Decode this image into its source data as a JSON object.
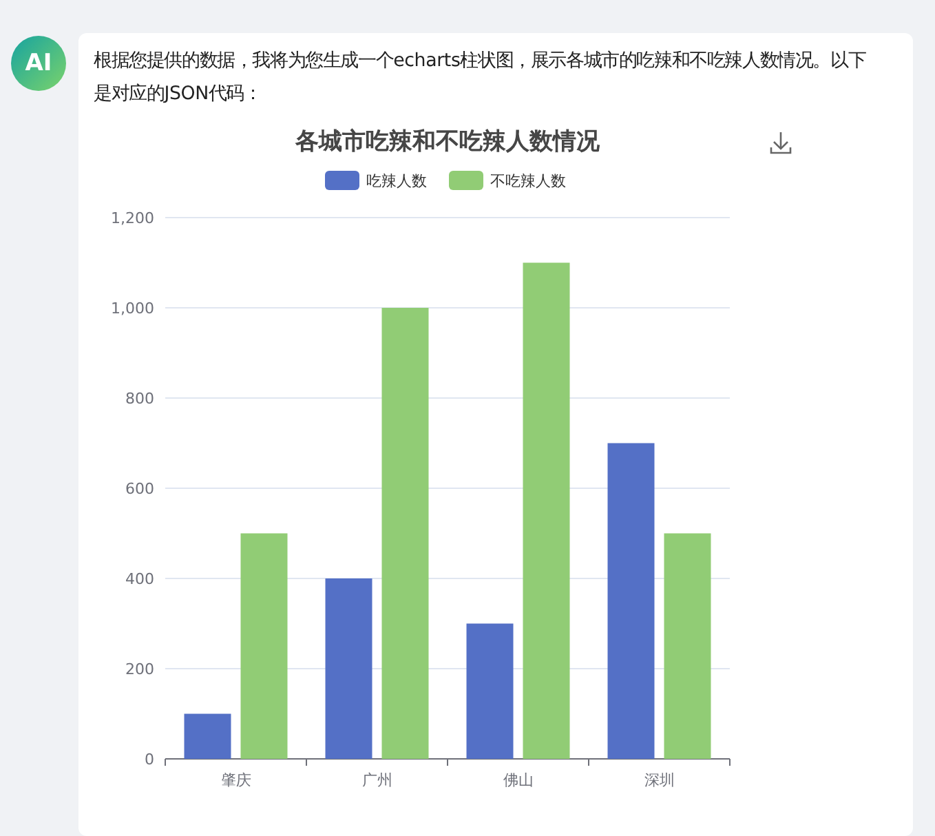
{
  "avatar": {
    "label": "AI"
  },
  "message": {
    "text": "根据您提供的数据，我将为您生成一个echarts柱状图，展示各城市的吃辣和不吃辣人数情况。以下是对应的JSON代码：",
    "chart_data": {
      "type": "bar",
      "title": "各城市吃辣和不吃辣人数情况",
      "categories": [
        "肇庆",
        "广州",
        "佛山",
        "深圳"
      ],
      "series": [
        {
          "name": "吃辣人数",
          "color": "#5470c6",
          "values": [
            100,
            400,
            300,
            700
          ]
        },
        {
          "name": "不吃辣人数",
          "color": "#91cc75",
          "values": [
            500,
            1000,
            1100,
            500
          ]
        }
      ],
      "ylim": [
        0,
        1200
      ],
      "grid": true,
      "legend": true,
      "yticks": [
        0,
        {
          "value": 200,
          "label": "200"
        },
        {
          "value": 400,
          "label": "400"
        },
        {
          "value": 600,
          "label": "600"
        },
        {
          "value": 800,
          "label": "800"
        },
        {
          "value": 1000,
          "label": "1,000"
        },
        {
          "value": 1200,
          "label": "1,200"
        }
      ]
    }
  }
}
